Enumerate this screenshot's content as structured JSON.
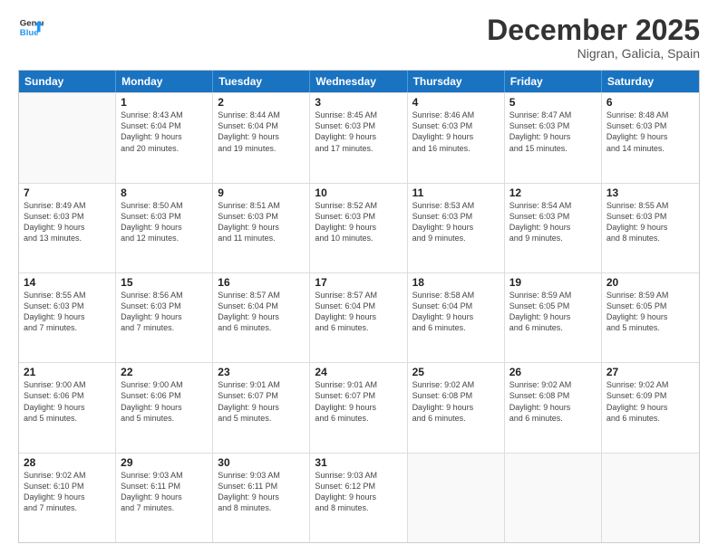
{
  "logo": {
    "line1": "General",
    "line2": "Blue"
  },
  "title": "December 2025",
  "location": "Nigran, Galicia, Spain",
  "weekdays": [
    "Sunday",
    "Monday",
    "Tuesday",
    "Wednesday",
    "Thursday",
    "Friday",
    "Saturday"
  ],
  "rows": [
    [
      {
        "date": "",
        "info": ""
      },
      {
        "date": "1",
        "info": "Sunrise: 8:43 AM\nSunset: 6:04 PM\nDaylight: 9 hours\nand 20 minutes."
      },
      {
        "date": "2",
        "info": "Sunrise: 8:44 AM\nSunset: 6:04 PM\nDaylight: 9 hours\nand 19 minutes."
      },
      {
        "date": "3",
        "info": "Sunrise: 8:45 AM\nSunset: 6:03 PM\nDaylight: 9 hours\nand 17 minutes."
      },
      {
        "date": "4",
        "info": "Sunrise: 8:46 AM\nSunset: 6:03 PM\nDaylight: 9 hours\nand 16 minutes."
      },
      {
        "date": "5",
        "info": "Sunrise: 8:47 AM\nSunset: 6:03 PM\nDaylight: 9 hours\nand 15 minutes."
      },
      {
        "date": "6",
        "info": "Sunrise: 8:48 AM\nSunset: 6:03 PM\nDaylight: 9 hours\nand 14 minutes."
      }
    ],
    [
      {
        "date": "7",
        "info": "Sunrise: 8:49 AM\nSunset: 6:03 PM\nDaylight: 9 hours\nand 13 minutes."
      },
      {
        "date": "8",
        "info": "Sunrise: 8:50 AM\nSunset: 6:03 PM\nDaylight: 9 hours\nand 12 minutes."
      },
      {
        "date": "9",
        "info": "Sunrise: 8:51 AM\nSunset: 6:03 PM\nDaylight: 9 hours\nand 11 minutes."
      },
      {
        "date": "10",
        "info": "Sunrise: 8:52 AM\nSunset: 6:03 PM\nDaylight: 9 hours\nand 10 minutes."
      },
      {
        "date": "11",
        "info": "Sunrise: 8:53 AM\nSunset: 6:03 PM\nDaylight: 9 hours\nand 9 minutes."
      },
      {
        "date": "12",
        "info": "Sunrise: 8:54 AM\nSunset: 6:03 PM\nDaylight: 9 hours\nand 9 minutes."
      },
      {
        "date": "13",
        "info": "Sunrise: 8:55 AM\nSunset: 6:03 PM\nDaylight: 9 hours\nand 8 minutes."
      }
    ],
    [
      {
        "date": "14",
        "info": "Sunrise: 8:55 AM\nSunset: 6:03 PM\nDaylight: 9 hours\nand 7 minutes."
      },
      {
        "date": "15",
        "info": "Sunrise: 8:56 AM\nSunset: 6:03 PM\nDaylight: 9 hours\nand 7 minutes."
      },
      {
        "date": "16",
        "info": "Sunrise: 8:57 AM\nSunset: 6:04 PM\nDaylight: 9 hours\nand 6 minutes."
      },
      {
        "date": "17",
        "info": "Sunrise: 8:57 AM\nSunset: 6:04 PM\nDaylight: 9 hours\nand 6 minutes."
      },
      {
        "date": "18",
        "info": "Sunrise: 8:58 AM\nSunset: 6:04 PM\nDaylight: 9 hours\nand 6 minutes."
      },
      {
        "date": "19",
        "info": "Sunrise: 8:59 AM\nSunset: 6:05 PM\nDaylight: 9 hours\nand 6 minutes."
      },
      {
        "date": "20",
        "info": "Sunrise: 8:59 AM\nSunset: 6:05 PM\nDaylight: 9 hours\nand 5 minutes."
      }
    ],
    [
      {
        "date": "21",
        "info": "Sunrise: 9:00 AM\nSunset: 6:06 PM\nDaylight: 9 hours\nand 5 minutes."
      },
      {
        "date": "22",
        "info": "Sunrise: 9:00 AM\nSunset: 6:06 PM\nDaylight: 9 hours\nand 5 minutes."
      },
      {
        "date": "23",
        "info": "Sunrise: 9:01 AM\nSunset: 6:07 PM\nDaylight: 9 hours\nand 5 minutes."
      },
      {
        "date": "24",
        "info": "Sunrise: 9:01 AM\nSunset: 6:07 PM\nDaylight: 9 hours\nand 6 minutes."
      },
      {
        "date": "25",
        "info": "Sunrise: 9:02 AM\nSunset: 6:08 PM\nDaylight: 9 hours\nand 6 minutes."
      },
      {
        "date": "26",
        "info": "Sunrise: 9:02 AM\nSunset: 6:08 PM\nDaylight: 9 hours\nand 6 minutes."
      },
      {
        "date": "27",
        "info": "Sunrise: 9:02 AM\nSunset: 6:09 PM\nDaylight: 9 hours\nand 6 minutes."
      }
    ],
    [
      {
        "date": "28",
        "info": "Sunrise: 9:02 AM\nSunset: 6:10 PM\nDaylight: 9 hours\nand 7 minutes."
      },
      {
        "date": "29",
        "info": "Sunrise: 9:03 AM\nSunset: 6:11 PM\nDaylight: 9 hours\nand 7 minutes."
      },
      {
        "date": "30",
        "info": "Sunrise: 9:03 AM\nSunset: 6:11 PM\nDaylight: 9 hours\nand 8 minutes."
      },
      {
        "date": "31",
        "info": "Sunrise: 9:03 AM\nSunset: 6:12 PM\nDaylight: 9 hours\nand 8 minutes."
      },
      {
        "date": "",
        "info": ""
      },
      {
        "date": "",
        "info": ""
      },
      {
        "date": "",
        "info": ""
      }
    ]
  ]
}
